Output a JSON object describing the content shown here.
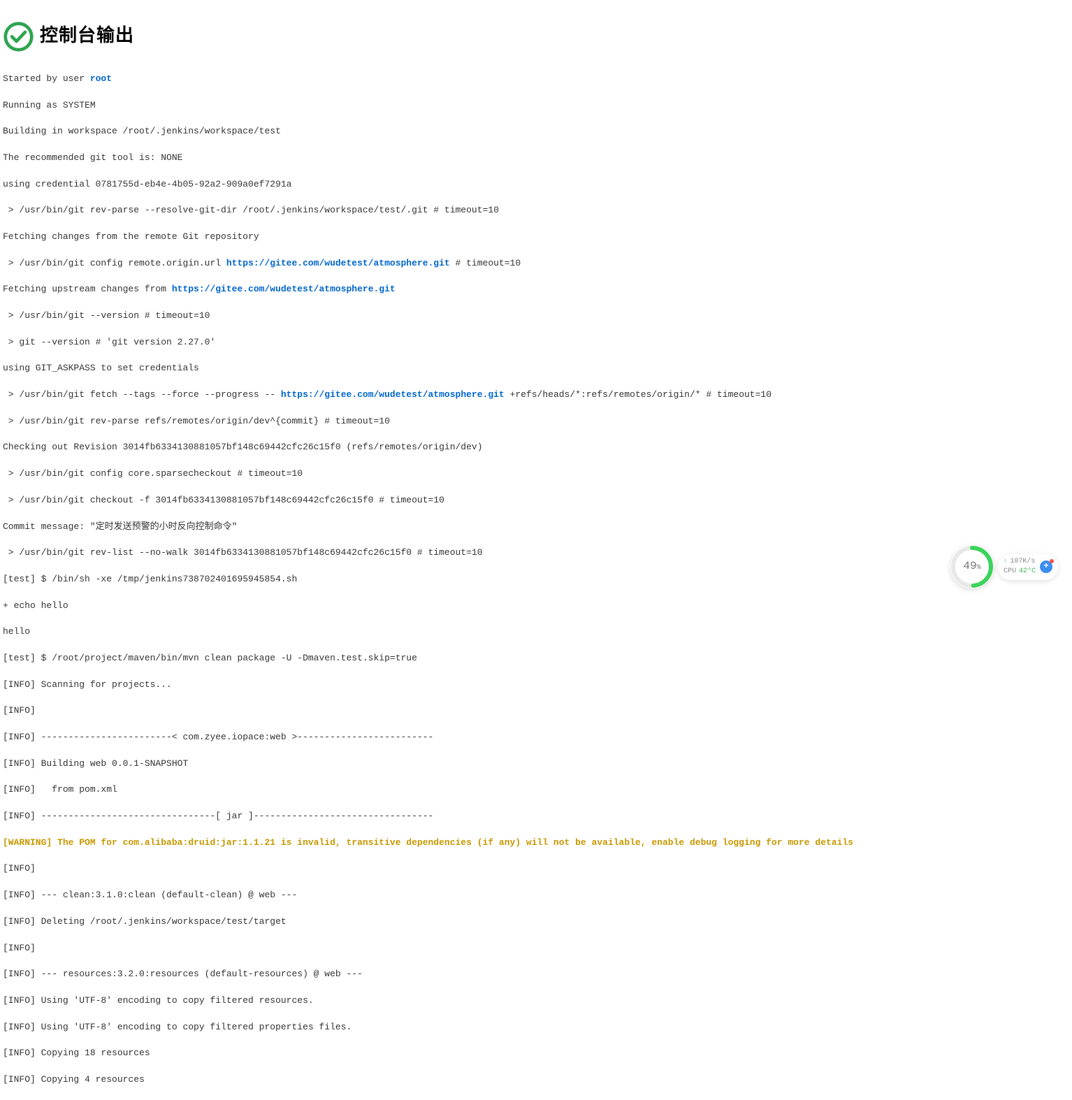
{
  "header": {
    "title": "控制台输出",
    "icon_color": "#2ea44f"
  },
  "console": {
    "started_by_prefix": "Started by user ",
    "user_link": "root",
    "line_running": "Running as SYSTEM",
    "line_building": "Building in workspace /root/.jenkins/workspace/test",
    "line_git_tool": "The recommended git tool is: NONE",
    "line_credential": "using credential 0781755d-eb4e-4b05-92a2-909a0ef7291a",
    "line_revparse_dir": " > /usr/bin/git rev-parse --resolve-git-dir /root/.jenkins/workspace/test/.git # timeout=10",
    "line_fetching": "Fetching changes from the remote Git repository",
    "line_config_remote_prefix": " > /usr/bin/git config remote.origin.url ",
    "repo_url": "https://gitee.com/wudetest/atmosphere.git",
    "line_config_remote_suffix": " # timeout=10",
    "line_fetch_upstream_prefix": "Fetching upstream changes from ",
    "line_git_version": " > /usr/bin/git --version # timeout=10",
    "line_git_version_out": " > git --version # 'git version 2.27.0'",
    "line_askpass": "using GIT_ASKPASS to set credentials ",
    "line_fetch_prefix": " > /usr/bin/git fetch --tags --force --progress -- ",
    "line_fetch_suffix": " +refs/heads/*:refs/remotes/origin/* # timeout=10",
    "line_revparse_refs": " > /usr/bin/git rev-parse refs/remotes/origin/dev^{commit} # timeout=10",
    "line_checkout_rev": "Checking out Revision 3014fb6334130881057bf148c69442cfc26c15f0 (refs/remotes/origin/dev)",
    "line_sparsecheckout": " > /usr/bin/git config core.sparsecheckout # timeout=10",
    "line_checkout_f": " > /usr/bin/git checkout -f 3014fb6334130881057bf148c69442cfc26c15f0 # timeout=10",
    "line_commit_msg": "Commit message: \"定时发送预警的小时反向控制命令\"",
    "line_revlist": " > /usr/bin/git rev-list --no-walk 3014fb6334130881057bf148c69442cfc26c15f0 # timeout=10",
    "line_sh_tmp": "[test] $ /bin/sh -xe /tmp/jenkins738702401695945854.sh",
    "line_echo": "+ echo hello",
    "line_hello": "hello",
    "line_mvn": "[test] $ /root/project/maven/bin/mvn clean package -U -Dmaven.test.skip=true",
    "line_info_scan": "[INFO] Scanning for projects...",
    "line_info_blank1": "[INFO] ",
    "line_info_sep1": "[INFO] ------------------------< com.zyee.iopace:web >-------------------------",
    "line_info_build": "[INFO] Building web 0.0.1-SNAPSHOT",
    "line_info_pom": "[INFO]   from pom.xml",
    "line_info_sep2": "[INFO] --------------------------------[ jar ]---------------------------------",
    "line_warning": "[WARNING] The POM for com.alibaba:druid:jar:1.1.21 is invalid, transitive dependencies (if any) will not be available, enable debug logging for more details",
    "line_info_blank2": "[INFO] ",
    "line_info_clean": "[INFO] --- clean:3.1.0:clean (default-clean) @ web ---",
    "line_info_delete": "[INFO] Deleting /root/.jenkins/workspace/test/target",
    "line_info_blank3": "[INFO] ",
    "line_info_resources": "[INFO] --- resources:3.2.0:resources (default-resources) @ web ---",
    "line_info_utf8_1": "[INFO] Using 'UTF-8' encoding to copy filtered resources.",
    "line_info_utf8_2": "[INFO] Using 'UTF-8' encoding to copy filtered properties files.",
    "line_info_copy18": "[INFO] Copying 18 resources",
    "line_info_copy4": "[INFO] Copying 4 resources"
  },
  "widget": {
    "percent": "49",
    "percent_unit": "%",
    "upload_speed": "107K/s",
    "cpu_label": "CPU",
    "cpu_temp": "42°C"
  }
}
